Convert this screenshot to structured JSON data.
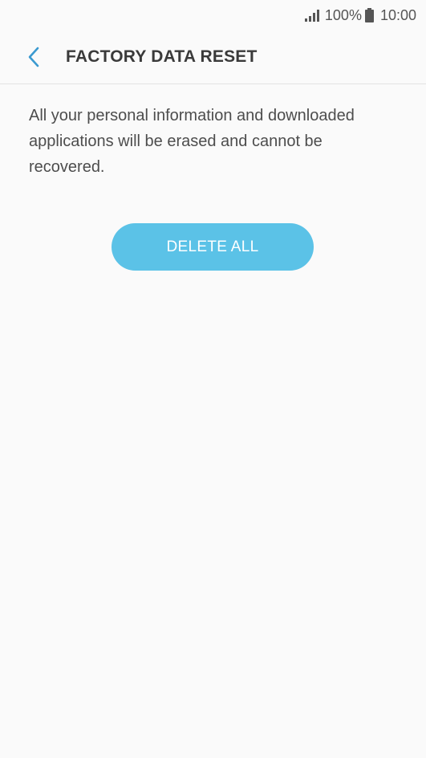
{
  "status_bar": {
    "signal_icon": "signal-bars-icon",
    "battery_percent": "100%",
    "battery_icon": "battery-full-icon",
    "time": "10:00"
  },
  "header": {
    "back_icon": "chevron-left-icon",
    "title": "FACTORY DATA RESET"
  },
  "main": {
    "description": "All your personal information and downloaded applications will be erased and cannot be recovered.",
    "delete_button_label": "DELETE ALL"
  },
  "colors": {
    "accent": "#5bc2e7",
    "back_arrow": "#3b9ad0",
    "background": "#fafafa"
  }
}
